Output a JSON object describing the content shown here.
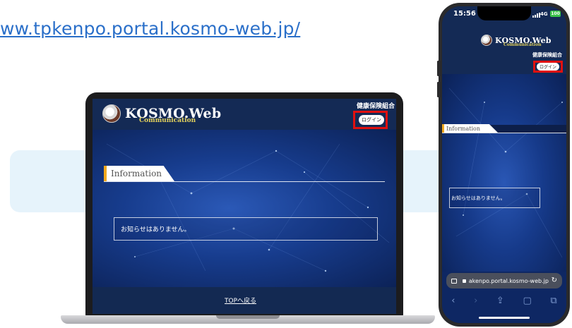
{
  "page": {
    "url_text": "ww.tpkenpo.portal.kosmo-web.jp/"
  },
  "site": {
    "logo_main": "KOSMO.Web",
    "logo_sub": "Communication",
    "org_name_desktop": "健康保険組合",
    "org_name_mobile": "健康保険組合",
    "login_label": "ログイン",
    "info_label": "Information",
    "notice_text": "お知らせはありません。",
    "top_link": "TOPへ戻る"
  },
  "phone": {
    "time": "15:56",
    "network": "4G",
    "battery": "100",
    "url_text": "akenpo.portal.kosmo-web.jp",
    "reload_glyph": "↻",
    "nav": {
      "back": "‹",
      "forward": "›",
      "share": "⇪",
      "bookmarks": "▢",
      "tabs": "⧉"
    }
  },
  "colors": {
    "link": "#2a6fc9",
    "header_navy": "#142a55",
    "accent_orange": "#f0a81e",
    "highlight_red": "#e01010",
    "logo_gold": "#e4d25c",
    "band_light_blue": "#e6f3fb"
  }
}
